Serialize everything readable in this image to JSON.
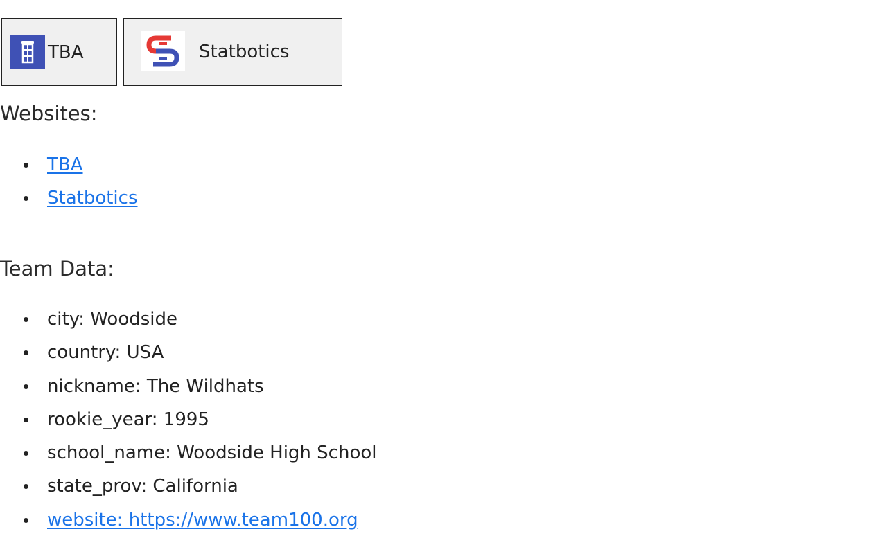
{
  "buttons": {
    "tba": {
      "label": "TBA",
      "icon": "tba-tower-icon",
      "color": "#3f51b5"
    },
    "statbotics": {
      "label": "Statbotics",
      "icon": "statbotics-logo-icon",
      "colors": [
        "#e53935",
        "#3f51b5"
      ]
    }
  },
  "websites": {
    "heading": "Websites:",
    "links": [
      {
        "label": "TBA"
      },
      {
        "label": "Statbotics"
      }
    ]
  },
  "team_data": {
    "heading": "Team Data:",
    "items": [
      {
        "text": "city: Woodside"
      },
      {
        "text": "country: USA"
      },
      {
        "text": "nickname: The Wildhats"
      },
      {
        "text": "rookie_year: 1995"
      },
      {
        "text": "school_name: Woodside High School"
      },
      {
        "text": "state_prov: California"
      },
      {
        "text": "website: https://www.team100.org"
      }
    ]
  },
  "colors": {
    "link": "#1a73e8",
    "button_bg": "#f0f0f0"
  }
}
